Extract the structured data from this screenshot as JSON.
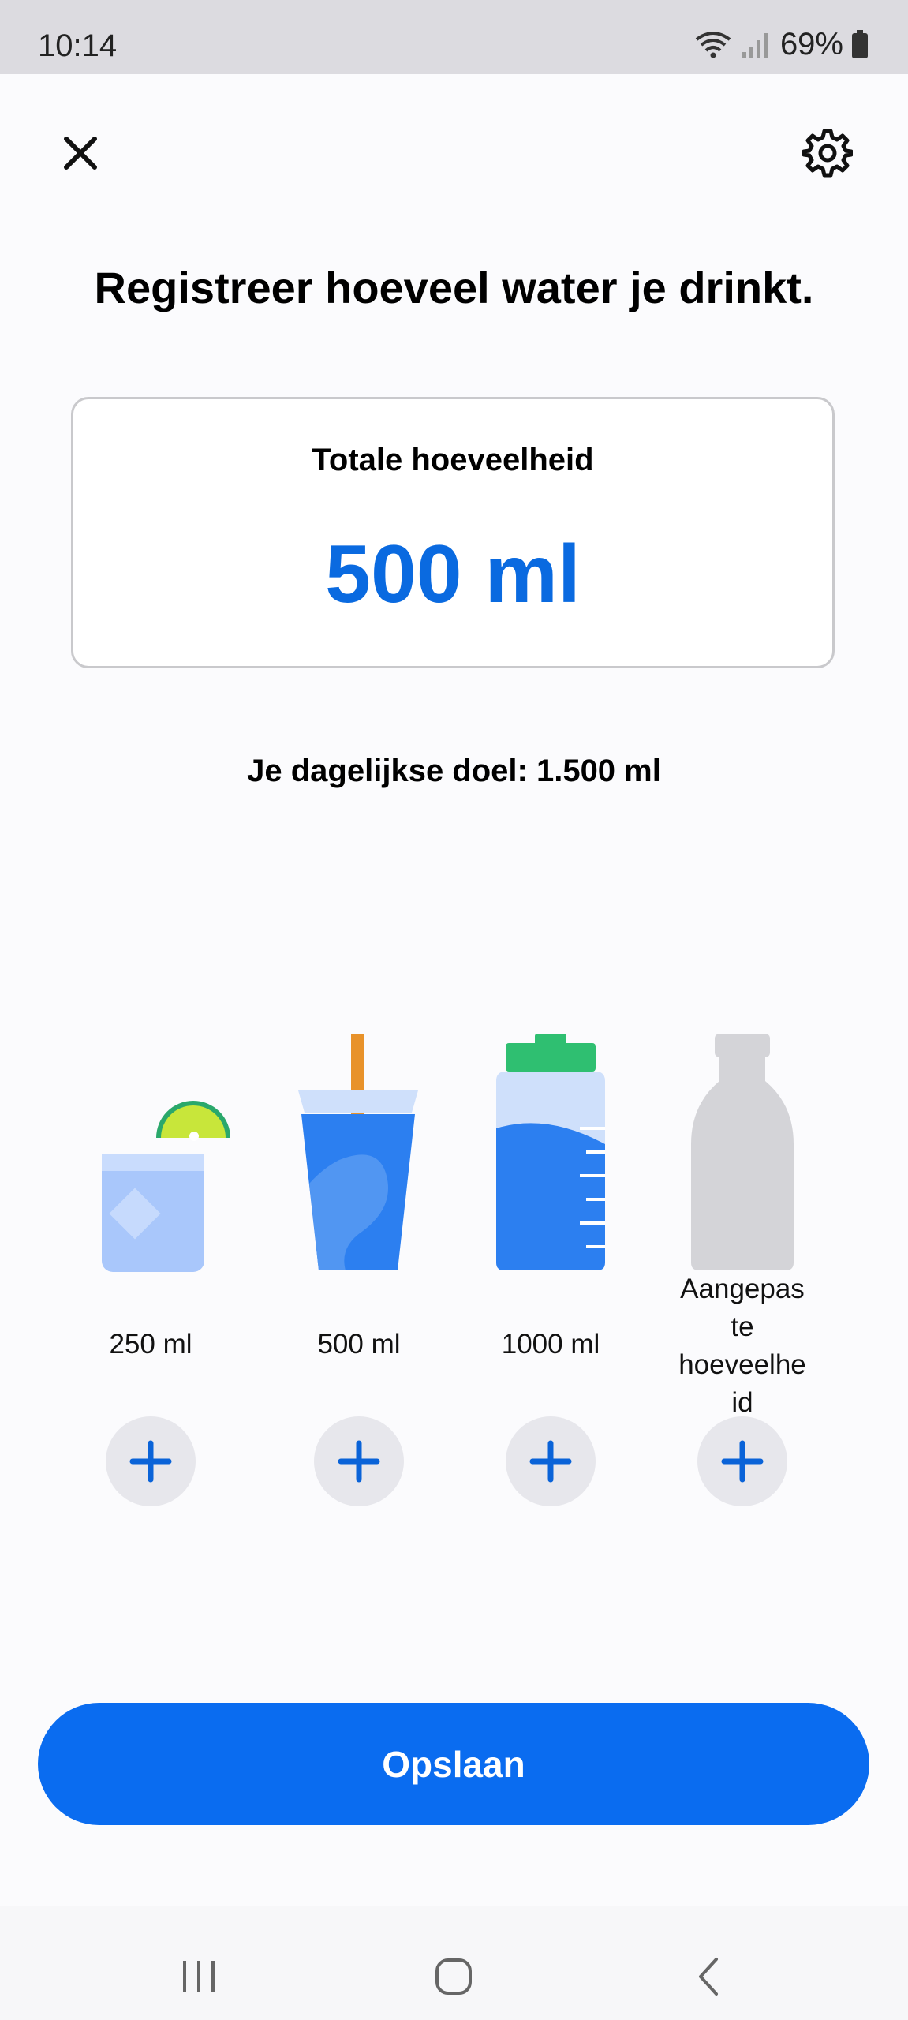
{
  "status_bar": {
    "time": "10:14",
    "battery": "69%"
  },
  "header": {
    "close_icon": "close-icon",
    "settings_icon": "gear-icon"
  },
  "title": "Registreer hoeveel water je drinkt.",
  "total": {
    "label": "Totale hoeveelheid",
    "value": "500 ml"
  },
  "goal": "Je dagelijkse doel: 1.500 ml",
  "drinks": [
    {
      "label": "250 ml",
      "icon": "glass-icon"
    },
    {
      "label": "500 ml",
      "icon": "cup-with-straw-icon"
    },
    {
      "label": "1000 ml",
      "icon": "water-bottle-icon"
    },
    {
      "label": "Aangepas\nte\nhoeveelhe\nid",
      "icon": "custom-bottle-icon"
    }
  ],
  "save_label": "Opslaan",
  "colors": {
    "accent": "#0a6ae0",
    "button": "#0a6cf0"
  }
}
